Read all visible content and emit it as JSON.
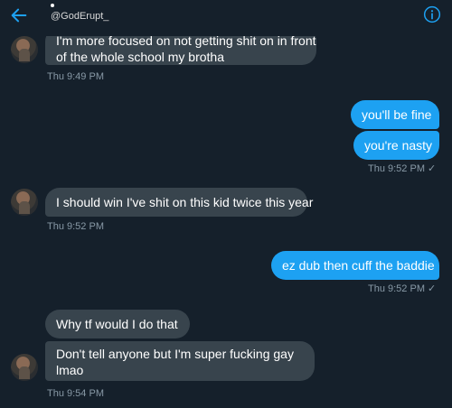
{
  "header": {
    "handle": "@GodErupt_"
  },
  "messages": [
    {
      "text_line1": "I'm more focused on not getting shit on in front",
      "text_line2": "of the whole school my brotha"
    },
    {
      "time": "Thu 9:49 PM"
    },
    {
      "text": "you'll be fine"
    },
    {
      "text": "you're nasty"
    },
    {
      "time": "Thu 9:52 PM",
      "check": "✓"
    },
    {
      "text": "I should win I've shit on this kid twice this year"
    },
    {
      "time": "Thu 9:52 PM"
    },
    {
      "text": "ez dub then cuff the baddie"
    },
    {
      "time": "Thu 9:52 PM",
      "check": "✓"
    },
    {
      "text": "Why tf would I do that"
    },
    {
      "text_line1": "Don't tell anyone but I'm super fucking gay",
      "text_line2": "lmao"
    },
    {
      "time": "Thu 9:54 PM"
    }
  ],
  "colors": {
    "background": "#15202b",
    "incoming_bubble": "#38444d",
    "outgoing_bubble": "#1da1f2",
    "accent": "#1da1f2",
    "timestamp": "#8899a6"
  },
  "icons": [
    "back-arrow-icon",
    "info-icon",
    "avatar"
  ]
}
